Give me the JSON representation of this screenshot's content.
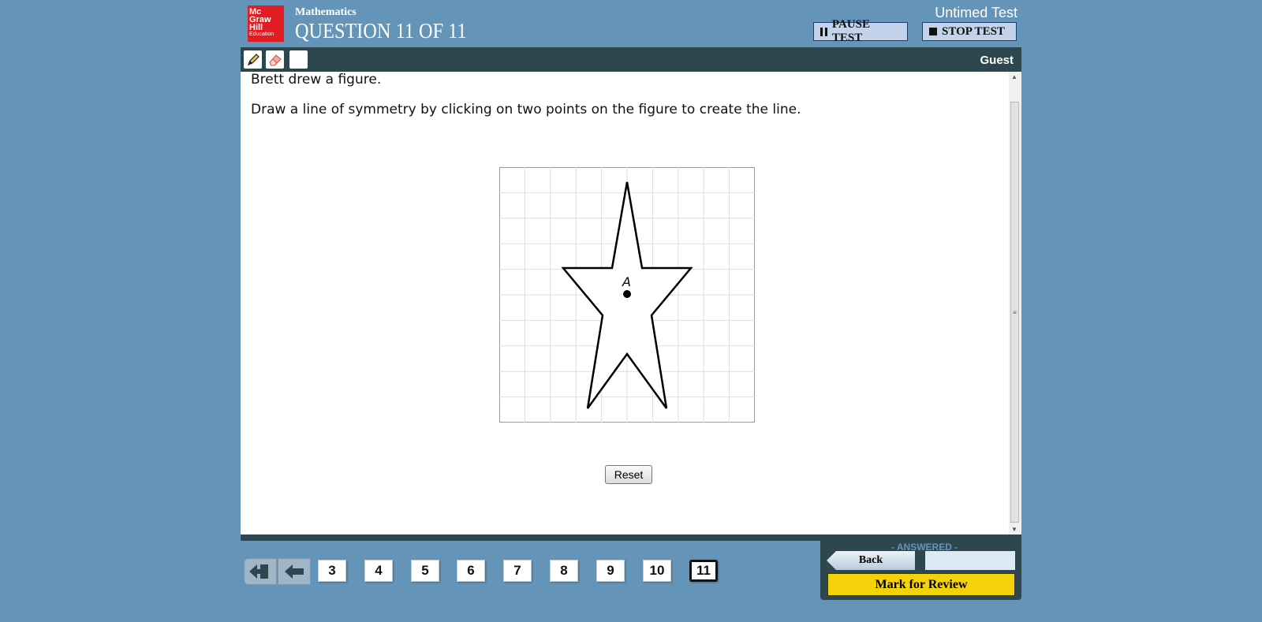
{
  "header": {
    "logo_lines": [
      "Mc",
      "Graw",
      "Hill",
      "Education"
    ],
    "subject": "Mathematics",
    "question_title": "QUESTION 11 OF 11",
    "test_mode": "Untimed Test",
    "pause_label": "PAUSE TEST",
    "stop_label": "STOP TEST"
  },
  "toolbar": {
    "tools": [
      "pencil-icon",
      "eraser-icon",
      "blank-tool"
    ],
    "user": "Guest"
  },
  "question": {
    "line1": "Brett drew a figure.",
    "line2": "Draw a line of symmetry by clicking on two points on the figure to create the line.",
    "point_label": "A",
    "reset_label": "Reset"
  },
  "navigation": {
    "question_numbers": [
      "3",
      "4",
      "5",
      "6",
      "7",
      "8",
      "9",
      "10",
      "11"
    ],
    "current": "11"
  },
  "review": {
    "status": "- ANSWERED -",
    "back_label": "Back",
    "mark_label": "Mark for Review"
  },
  "colors": {
    "background": "#6495b8",
    "toolbar": "#2e474f",
    "mark_button": "#f4d20a"
  }
}
